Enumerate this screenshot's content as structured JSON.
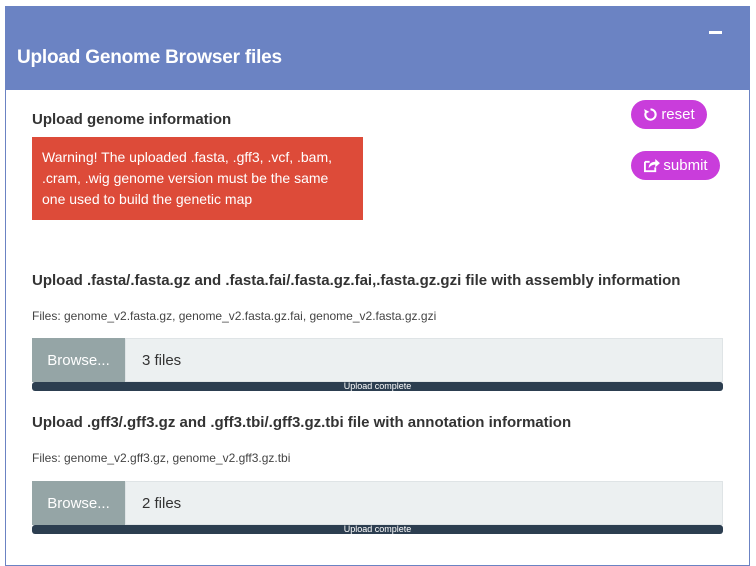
{
  "panel": {
    "title": "Upload Genome Browser files",
    "collapse_icon": "minus-icon"
  },
  "genome_info": {
    "heading": "Upload genome information",
    "warning": "Warning! The uploaded .fasta, .gff3, .vcf, .bam, .cram, .wig genome version must be the same one used to build the genetic map"
  },
  "buttons": {
    "reset_label": "reset",
    "reset_icon": "refresh-icon",
    "submit_label": "submit",
    "submit_icon": "share-icon",
    "color": "#c93ddb"
  },
  "fasta_upload": {
    "heading": "Upload .fasta/.fasta.gz and .fasta.fai/.fasta.gz.fai,.fasta.gz.gzi file with assembly information",
    "files_note": "Files: genome_v2.fasta.gz, genome_v2.fasta.gz.fai, genome_v2.fasta.gz.gzi",
    "browse_label": "Browse...",
    "value": "3 files",
    "progress_text": "Upload complete",
    "progress": 1.0
  },
  "gff3_upload": {
    "heading": "Upload .gff3/.gff3.gz and .gff3.tbi/.gff3.gz.tbi file with annotation information",
    "files_note": "Files: genome_v2.gff3.gz, genome_v2.gff3.gz.tbi",
    "browse_label": "Browse...",
    "value": "2 files",
    "progress_text": "Upload complete",
    "progress": 1.0
  },
  "colors": {
    "header": "#6b83c3",
    "warning": "#dd4b39",
    "progress": "#2c3e50",
    "browse": "#95a5a6"
  }
}
